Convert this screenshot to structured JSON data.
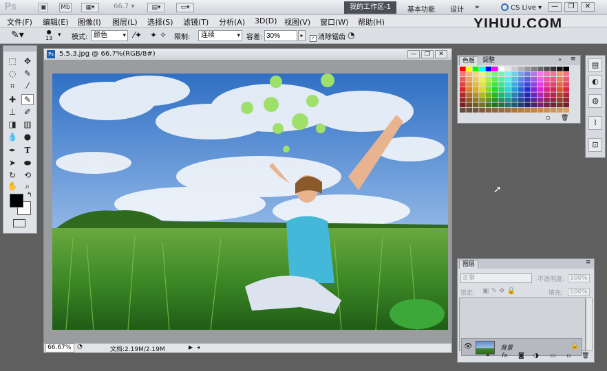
{
  "app": {
    "logo": "Ps",
    "zoom_display": "66.7",
    "workspace_active": "我的工作区-1",
    "workspace_links": [
      "基本功能",
      "设计",
      "»"
    ],
    "cs_live": "CS Live ▾",
    "window_controls": [
      "—",
      "❐",
      "✕"
    ]
  },
  "menu": [
    "文件(F)",
    "编辑(E)",
    "图像(I)",
    "图层(L)",
    "选择(S)",
    "滤镜(T)",
    "分析(A)",
    "3D(D)",
    "视图(V)",
    "窗口(W)",
    "帮助(H)"
  ],
  "watermark": "YIHUU.COM",
  "options": {
    "brush_size": "13",
    "mode_label": "模式:",
    "mode_value": "颜色",
    "sample_label": "限制:",
    "limits_value": "连续",
    "tolerance_label": "容差:",
    "tolerance_value": "30%",
    "antialias_label": "消除锯齿",
    "antialias_checked": true
  },
  "document": {
    "title": "5.5.3.jpg @ 66.7%(RGB/8#)",
    "zoom": "66.67%",
    "doc_info": "文档:2.19M/2.19M",
    "controls": [
      "—",
      "❐",
      "✕"
    ]
  },
  "color_panel": {
    "tabs": [
      "色板",
      "调整"
    ]
  },
  "layers_panel": {
    "tab": "图层",
    "blend_mode": "正常",
    "opacity_label": "不透明度:",
    "opacity_value": "100%",
    "lock_label": "锁定:",
    "fill_label": "填充:",
    "fill_value": "100%",
    "layer_name": "背景"
  },
  "tools": [
    "rect-marquee",
    "move",
    "lasso",
    "quick-select",
    "crop",
    "eyedropper",
    "healing",
    "brush",
    "stamp",
    "history-brush",
    "eraser",
    "gradient",
    "blur",
    "dodge",
    "pen",
    "type",
    "path-select",
    "shape",
    "3d-rotate",
    "3d-orbit",
    "hand",
    "zoom"
  ],
  "dock_icons": [
    "layers-icon",
    "adjust-icon",
    "masks-icon",
    "paths-icon",
    "transform-icon"
  ]
}
